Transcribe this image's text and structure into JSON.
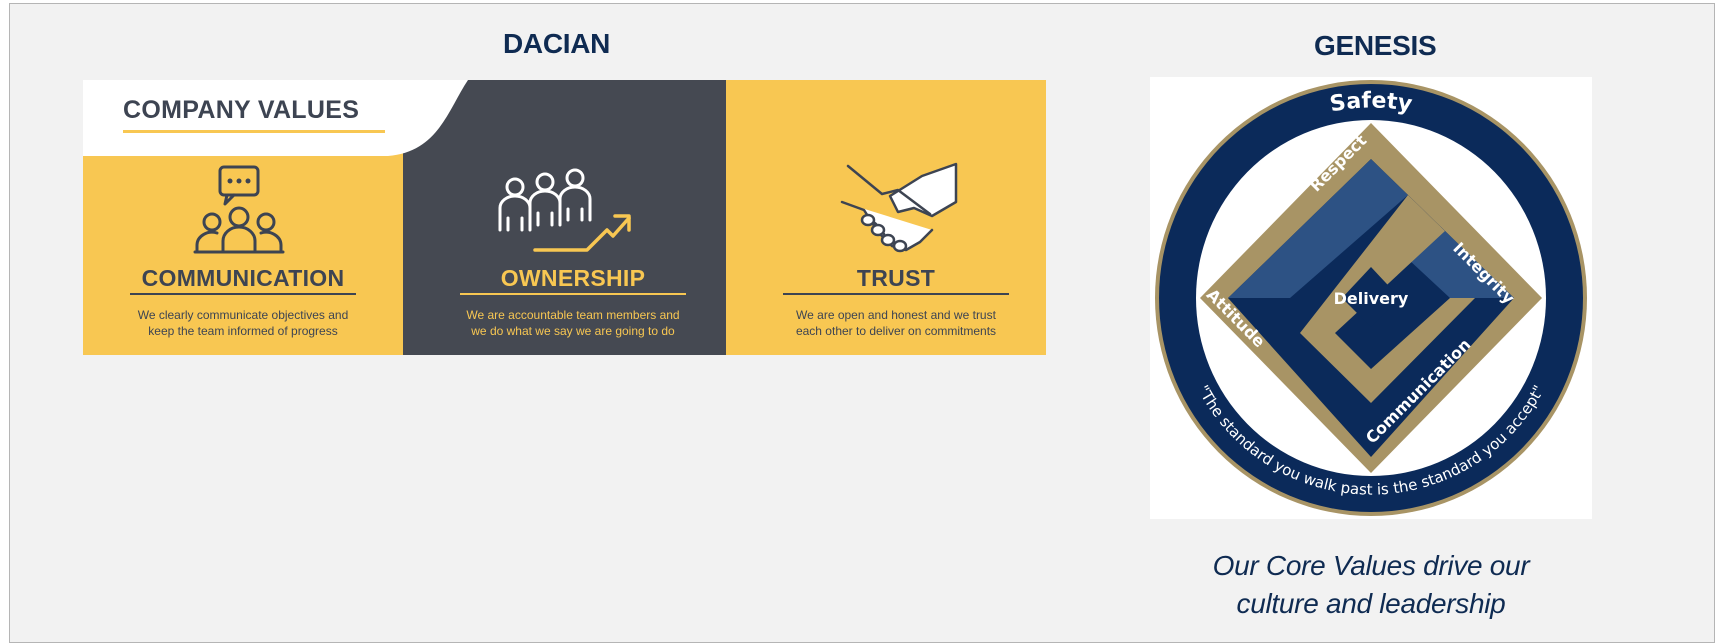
{
  "sections": {
    "dacian": {
      "title": "DACIAN",
      "banner": {
        "heading": "COMPANY VALUES",
        "values": [
          {
            "title": "COMMUNICATION",
            "line1": "We clearly communicate objectives and",
            "line2": "keep the team informed of progress",
            "icon": "team-chat-icon"
          },
          {
            "title": "OWNERSHIP",
            "line1": "We are accountable team members and",
            "line2": "we do what we say we are going to do",
            "icon": "team-growth-icon"
          },
          {
            "title": "TRUST",
            "line1": "We are open and honest and we trust",
            "line2": "each other to deliver on commitments",
            "icon": "handshake-icon"
          }
        ]
      }
    },
    "genesis": {
      "title": "GENESIS",
      "logo": {
        "top": "Safety",
        "left_upper": "Respect",
        "right": "Integrity",
        "left": "Attitude",
        "bottom_right": "Communication",
        "center": "Delivery",
        "motto": "\"The standard you walk past is the standard you accept\""
      },
      "caption_line1": "Our Core Values drive our",
      "caption_line2": "culture and leadership"
    }
  },
  "colors": {
    "heading": "#0f2b52",
    "yellow": "#f8c752",
    "charcoal": "#454952",
    "navy": "#0b2a5a",
    "gold": "#a89465",
    "steel_blue": "#2d5284"
  }
}
